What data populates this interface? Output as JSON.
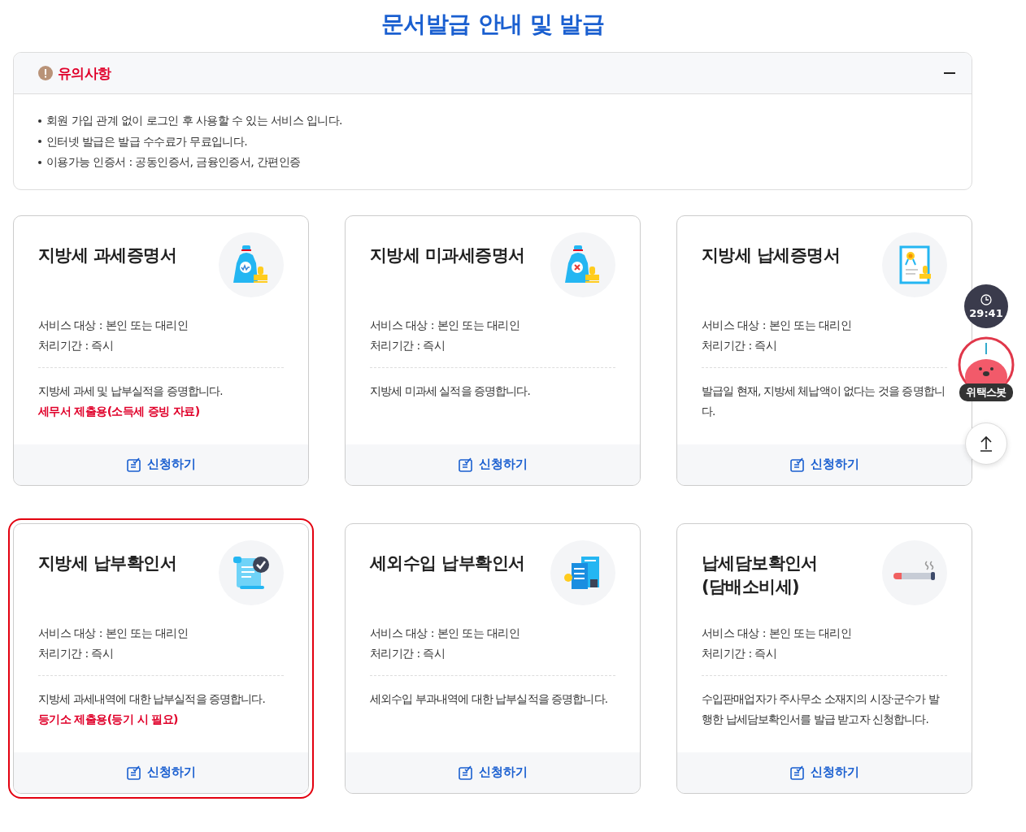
{
  "page_title": "문서발급 안내 및 발급",
  "notice": {
    "title": "유의사항",
    "expanded": true,
    "items": [
      "회원 가입 관계 없이 로그인 후 사용할 수 있는 서비스 입니다.",
      "인터넷 발급은 발급 수수료가 무료입니다.",
      "이용가능 인증서 : 공동인증서, 금융인증서, 간편인증"
    ]
  },
  "cards": [
    {
      "title": "지방세 과세증명서",
      "kind": "bag-won",
      "target": "서비스 대상 : 본인 또는 대리인",
      "period": "처리기간 : 즉시",
      "description": "지방세 과세 및 납부실적을 증명합니다.",
      "note": "세무서 제출용(소득세 증빙 자료)",
      "button": "신청하기",
      "selected": false
    },
    {
      "title": "지방세 미과세증명서",
      "kind": "bag-x",
      "target": "서비스 대상 : 본인 또는 대리인",
      "period": "처리기간 : 즉시",
      "description": "지방세 미과세 실적을 증명합니다.",
      "button": "신청하기",
      "selected": false
    },
    {
      "title": "지방세 납세증명서",
      "kind": "certificate",
      "target": "서비스 대상 : 본인 또는 대리인",
      "period": "처리기간 : 즉시",
      "description": "발급일 현재, 지방세 체납액이 없다는 것을 증명합니다.",
      "button": "신청하기",
      "selected": false
    },
    {
      "title": "지방세 납부확인서",
      "kind": "scroll",
      "target": "서비스 대상 : 본인 또는 대리인",
      "period": "처리기간 : 즉시",
      "description": "지방세 과세내역에 대한 납부실적을 증명합니다.",
      "note": "등기소 제출용(등기 시 필요)",
      "button": "신청하기",
      "selected": true
    },
    {
      "title": "세외수입 납부확인서",
      "kind": "documents",
      "target": "서비스 대상 : 본인 또는 대리인",
      "period": "처리기간 : 즉시",
      "description": "세외수입 부과내역에 대한 납부실적을 증명합니다.",
      "button": "신청하기",
      "selected": false
    },
    {
      "title": "납세담보확인서\n(담배소비세)",
      "kind": "cigarette",
      "target": "서비스 대상 : 본인 또는 대리인",
      "period": "처리기간 : 즉시",
      "description": "수입판매업자가 주사무소 소재지의 시장·군수가 발행한 납세담보확인서를 발급 받고자 신청합니다.",
      "button": "신청하기",
      "selected": false
    }
  ],
  "floating": {
    "timer": "29:41",
    "bot_label": "위택스봇"
  }
}
